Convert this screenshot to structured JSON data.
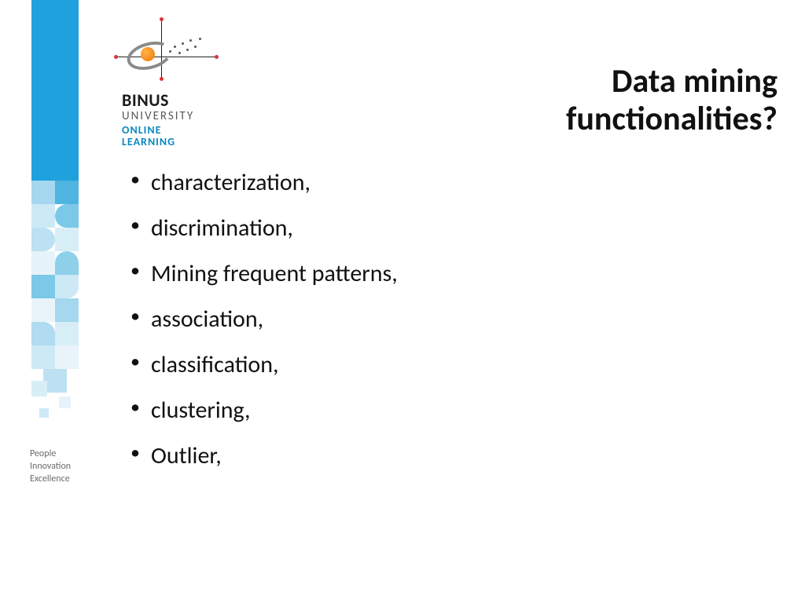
{
  "logo": {
    "line1": "BINUS",
    "line2": "UNIVERSITY",
    "line3": "ONLINE",
    "line4": "LEARNING"
  },
  "sidebar_tagline": {
    "l1": "People",
    "l2": "Innovation",
    "l3": "Excellence"
  },
  "title": {
    "line1": "Data mining",
    "line2": "functionalities?"
  },
  "bullets": [
    "characterization,",
    "discrimination,",
    "Mining frequent patterns,",
    "association,",
    "classification,",
    "clustering,",
    "Outlier,"
  ]
}
